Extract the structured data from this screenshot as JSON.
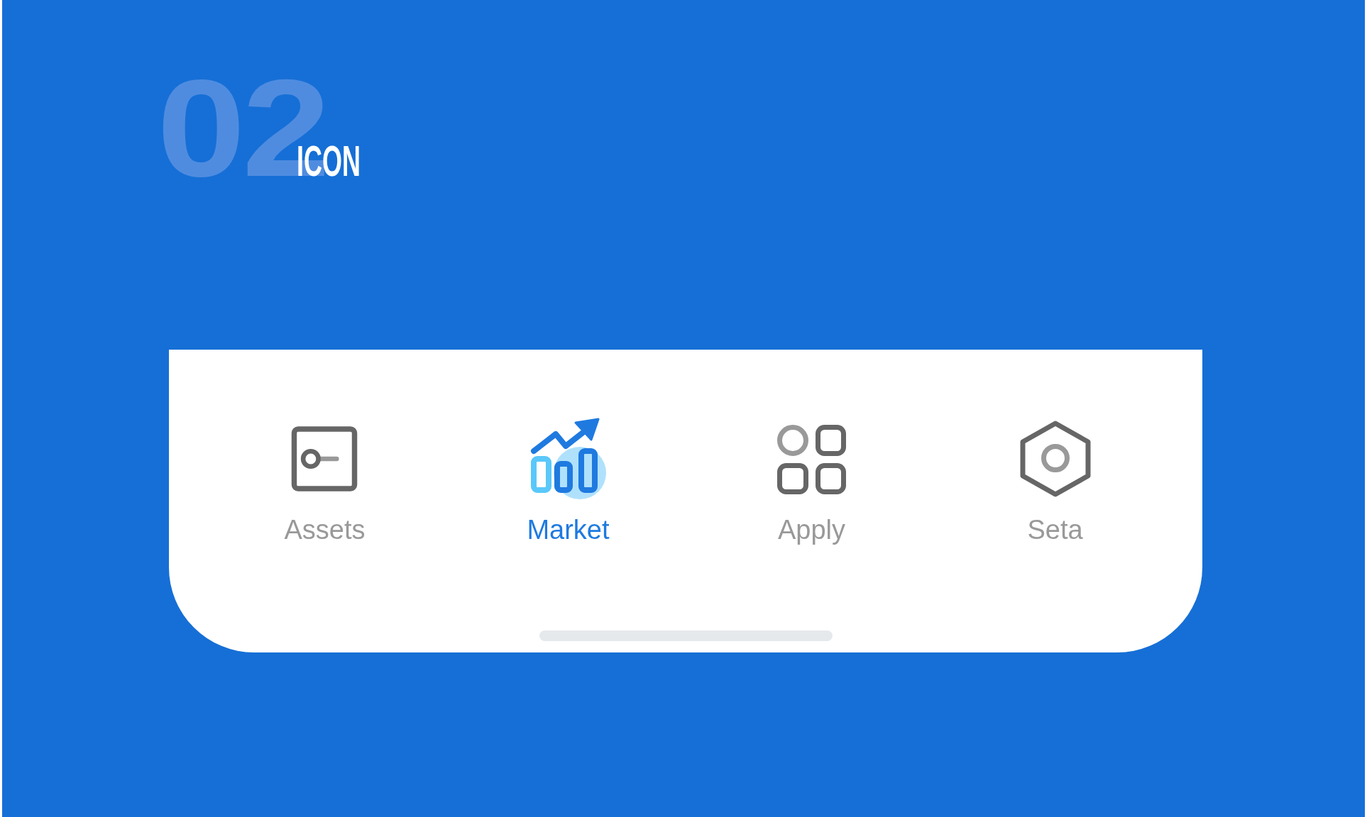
{
  "header": {
    "number": "02",
    "title": "ICON"
  },
  "tabs": [
    {
      "label": "Assets",
      "selected": false
    },
    {
      "label": "Market",
      "selected": true
    },
    {
      "label": "Apply",
      "selected": false
    },
    {
      "label": "Seta",
      "selected": false
    }
  ]
}
